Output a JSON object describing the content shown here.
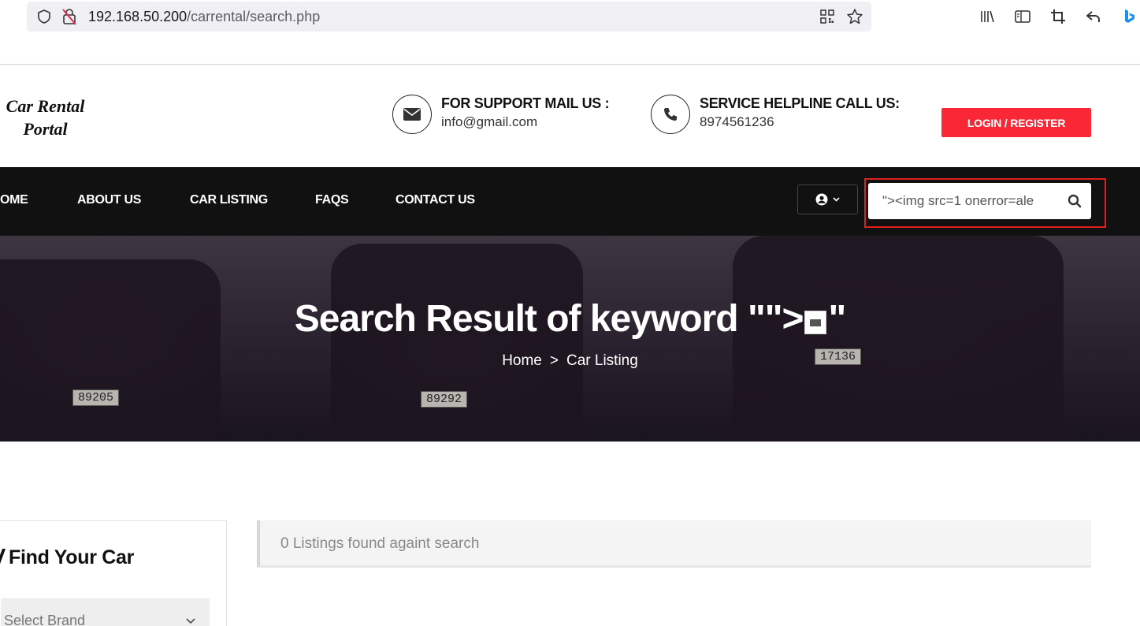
{
  "browser": {
    "url_host": "192.168.50.200",
    "url_path": "/carrental/search.php"
  },
  "header": {
    "logo_line1": "Car Rental",
    "logo_line2": "Portal",
    "support_title": "FOR SUPPORT MAIL US :",
    "support_email": "info@gmail.com",
    "helpline_title": "SERVICE HELPLINE CALL US:",
    "helpline_phone": "8974561236",
    "login_label": "LOGIN / REGISTER"
  },
  "nav": {
    "items": [
      "OME",
      "ABOUT US",
      "CAR LISTING",
      "FAQS",
      "CONTACT US"
    ],
    "search_value": "\"><img src=1 onerror=ale"
  },
  "hero": {
    "title_prefix": "Search Result of keyword \"\">",
    "title_suffix": "\"",
    "breadcrumb_home": "Home",
    "breadcrumb_sep": ">",
    "breadcrumb_current": "Car Listing",
    "plates": [
      "89205",
      "89292",
      "17136"
    ]
  },
  "sidebar": {
    "title": "Find Your Car",
    "brand_placeholder": "Select Brand"
  },
  "results": {
    "text": "0 Listings found againt search"
  },
  "colors": {
    "accent": "#fa2837",
    "nav_bg": "#111111",
    "highlight_outline": "#e0201f"
  }
}
